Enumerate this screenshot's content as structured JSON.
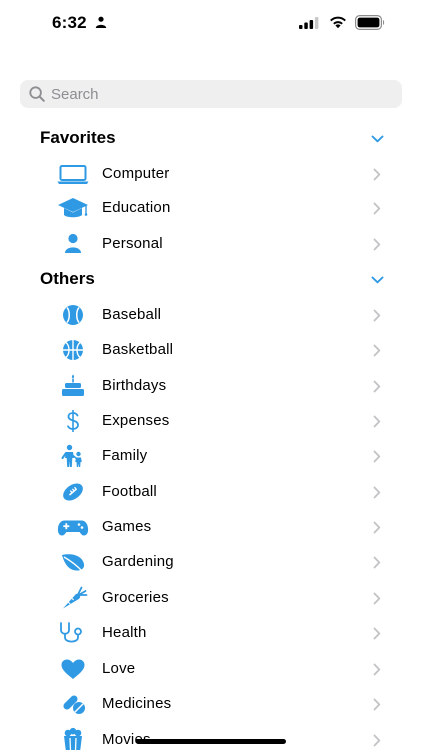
{
  "status_bar": {
    "time": "6:32",
    "person_icon": "person-fill-icon",
    "signal_icon": "cellular-signal-icon",
    "wifi_icon": "wifi-icon",
    "battery_icon": "battery-icon"
  },
  "search": {
    "placeholder": "Search",
    "icon": "magnifying-glass-icon"
  },
  "colors": {
    "accent": "#2f9ae3",
    "chevron": "#c4c4c7",
    "search_bg": "#efeff0",
    "placeholder": "#8d8d92"
  },
  "sections": [
    {
      "title": "Favorites",
      "expanded": true,
      "items": [
        {
          "label": "Computer",
          "icon": "laptop-icon"
        },
        {
          "label": "Education",
          "icon": "graduation-cap-icon"
        },
        {
          "label": "Personal",
          "icon": "person-icon"
        }
      ]
    },
    {
      "title": "Others",
      "expanded": true,
      "items": [
        {
          "label": "Baseball",
          "icon": "baseball-icon"
        },
        {
          "label": "Basketball",
          "icon": "basketball-icon"
        },
        {
          "label": "Birthdays",
          "icon": "birthday-cake-icon"
        },
        {
          "label": "Expenses",
          "icon": "dollar-sign-icon"
        },
        {
          "label": "Family",
          "icon": "family-icon"
        },
        {
          "label": "Football",
          "icon": "football-icon"
        },
        {
          "label": "Games",
          "icon": "game-controller-icon"
        },
        {
          "label": "Gardening",
          "icon": "leaf-icon"
        },
        {
          "label": "Groceries",
          "icon": "carrot-icon"
        },
        {
          "label": "Health",
          "icon": "stethoscope-icon"
        },
        {
          "label": "Love",
          "icon": "heart-icon"
        },
        {
          "label": "Medicines",
          "icon": "pills-icon"
        },
        {
          "label": "Movies",
          "icon": "popcorn-icon"
        }
      ]
    }
  ]
}
